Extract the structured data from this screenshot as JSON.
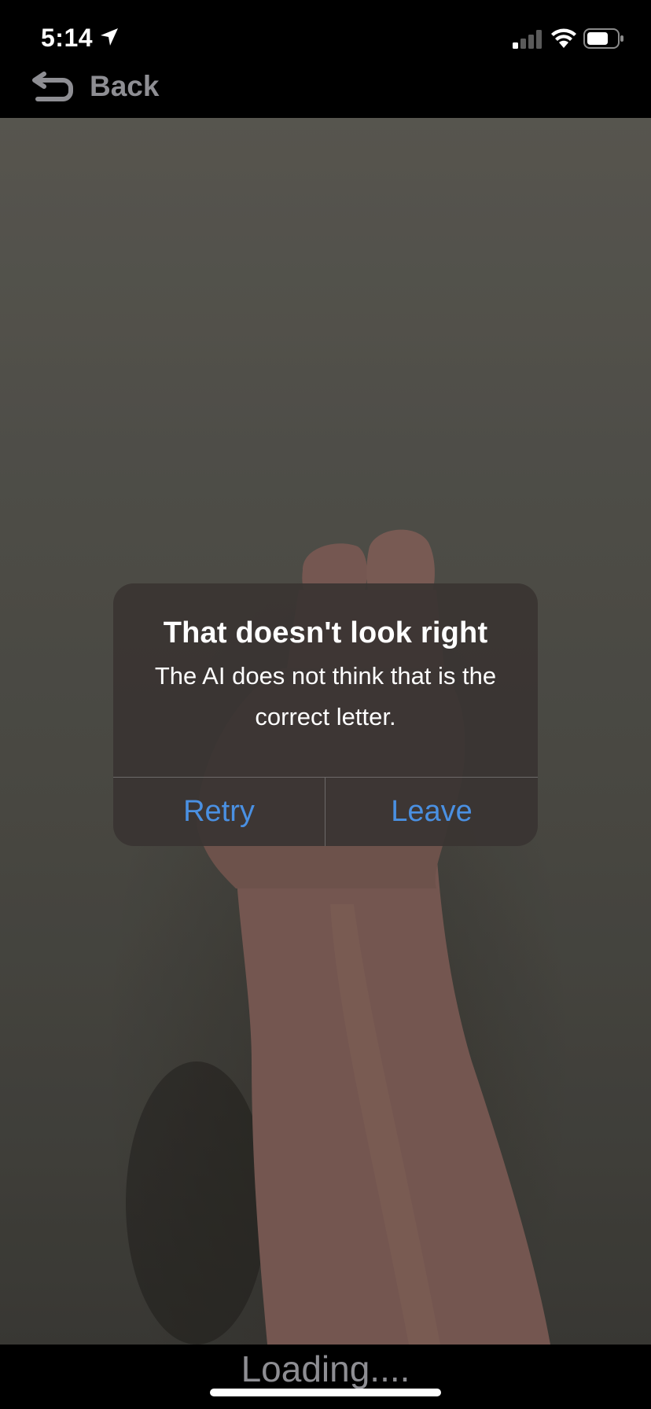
{
  "status_bar": {
    "time": "5:14"
  },
  "nav": {
    "back_label": "Back"
  },
  "alert": {
    "title": "That doesn't look right",
    "message": "The AI does not think that is the correct letter.",
    "retry_label": "Retry",
    "leave_label": "Leave"
  },
  "footer": {
    "loading_text": "Loading...."
  },
  "colors": {
    "accent": "#4a90e2",
    "muted_text": "#8e8e93"
  }
}
